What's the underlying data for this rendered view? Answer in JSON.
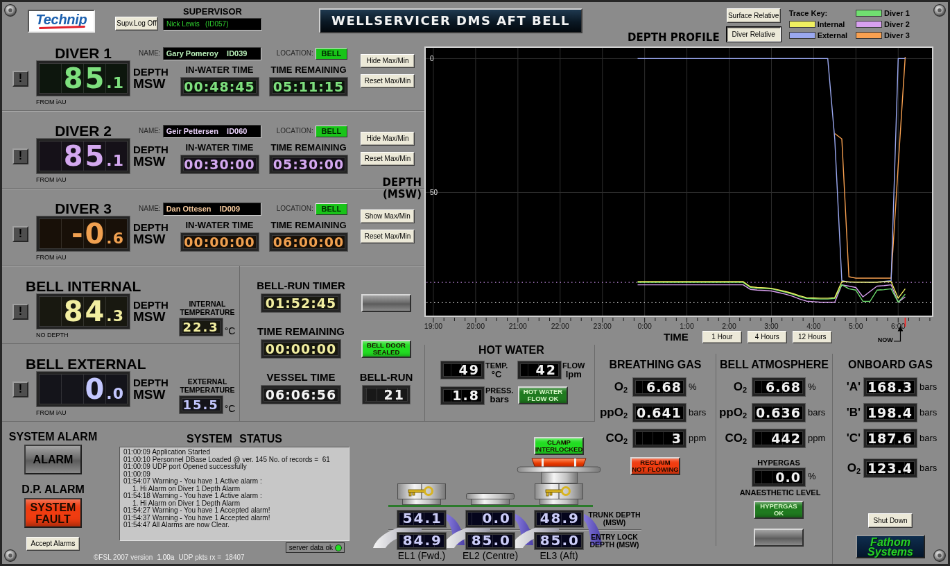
{
  "window": {
    "title": "WELLSERVICER DMS AFT BELL",
    "logo": "Technip",
    "vendor_logo": "Fathom Systems"
  },
  "supervisor": {
    "button": "Supv.Log Off",
    "label": "SUPERVISOR",
    "value": "Nick Lewis   (ID057)"
  },
  "divers": [
    {
      "title": "DIVER 1",
      "color": "#7ee07e",
      "alarm_button": "!",
      "name_label": "NAME:",
      "name": "Gary Pomeroy    ID039",
      "location_label": "LOCATION:",
      "location": "BELL",
      "depth": "85.1",
      "depth_label": "DEPTH",
      "depth_unit": "MSW",
      "source": "FROM iAU",
      "in_water_label": "IN-WATER TIME",
      "in_water": "00:48:45",
      "remaining_label": "TIME REMAINING",
      "remaining": "05:11:15",
      "buttons": [
        "Hide Max/Min",
        "Reset Max/Min"
      ]
    },
    {
      "title": "DIVER 2",
      "color": "#d4a8f0",
      "alarm_button": "!",
      "name_label": "NAME:",
      "name": "Geir Pettersen    ID060",
      "location_label": "LOCATION:",
      "location": "BELL",
      "depth": "85.1",
      "depth_label": "DEPTH",
      "depth_unit": "MSW",
      "source": "FROM iAU",
      "in_water_label": "IN-WATER TIME",
      "in_water": "00:30:00",
      "remaining_label": "TIME REMAINING",
      "remaining": "05:30:00",
      "buttons": [
        "Hide Max/Min",
        "Reset Max/Min"
      ]
    },
    {
      "title": "DIVER 3",
      "color": "#f0a050",
      "alarm_button": "!",
      "name_label": "NAME:",
      "name": "Dan Ottesen    ID009",
      "location_label": "LOCATION:",
      "location": "BELL",
      "depth": "-0.6",
      "depth_label": "DEPTH",
      "depth_unit": "MSW",
      "source": "FROM iAU",
      "in_water_label": "IN-WATER TIME",
      "in_water": "00:00:00",
      "remaining_label": "TIME REMAINING",
      "remaining": "06:00:00",
      "buttons": [
        "Show Max/Min",
        "Reset Max/Min"
      ]
    }
  ],
  "depth_profile": {
    "view_buttons": [
      {
        "text": "Surface Relative",
        "selected": false
      },
      {
        "text": "Diver Relative",
        "selected": true
      }
    ],
    "trace_key_label": "Trace Key:",
    "range_buttons": [
      "1 Hour",
      "4 Hours",
      "12 Hours"
    ],
    "now_label": "NOW",
    "chart_data": {
      "type": "line",
      "title": "DEPTH PROFILE",
      "xlabel": "TIME",
      "ylabel": "DEPTH (MSW)",
      "grid": true,
      "categories": [
        "19:00",
        null,
        null,
        null,
        null,
        null,
        "20:00",
        null,
        null,
        null,
        null,
        null,
        "21:00",
        null,
        null,
        null,
        null,
        null,
        "22:00",
        null,
        null,
        null,
        null,
        null,
        "23:00",
        null,
        null,
        null,
        null,
        null,
        "0:00",
        null,
        null,
        null,
        null,
        null,
        "1:00",
        null,
        null,
        null,
        null,
        null,
        "2:00",
        null,
        null,
        null,
        null,
        null,
        "3:00",
        null,
        null,
        null,
        null,
        null,
        "4:00",
        null,
        null,
        null,
        null,
        null,
        "5:00",
        null,
        null,
        null,
        null,
        null,
        "6:00",
        null,
        null,
        null,
        null
      ],
      "series": [
        {
          "name": "Internal",
          "color": "#f0f060",
          "values": [
            null,
            null,
            null,
            null,
            null,
            null,
            null,
            null,
            null,
            null,
            null,
            null,
            null,
            null,
            null,
            null,
            null,
            null,
            null,
            null,
            null,
            null,
            null,
            null,
            null,
            null,
            null,
            null,
            null,
            83.3,
            83.3,
            83.3,
            83.3,
            83.3,
            83.3,
            83.3,
            83.3,
            83.3,
            83.3,
            83.3,
            83.3,
            83.3,
            83.3,
            83.3,
            83.3,
            85.2,
            85.5,
            85.6,
            85.8,
            86.4,
            87.0,
            87.7,
            88.6,
            89.3,
            89.4,
            89.5,
            89.5,
            89.3,
            83.3,
            83.4,
            83.5,
            83.5,
            83.6,
            83.5,
            83.4,
            83.3,
            89.5,
            86,
            null,
            null,
            null
          ]
        },
        {
          "name": "External",
          "color": "#9aa8f0",
          "values": [
            null,
            null,
            null,
            null,
            null,
            null,
            null,
            null,
            null,
            null,
            null,
            null,
            null,
            null,
            null,
            null,
            null,
            null,
            null,
            null,
            null,
            null,
            null,
            null,
            null,
            null,
            null,
            null,
            null,
            0,
            0,
            0,
            0,
            0,
            0,
            0,
            0,
            0,
            0,
            0,
            0,
            0,
            0,
            0,
            0,
            0,
            0,
            0,
            0,
            0,
            0,
            0,
            0,
            0,
            0,
            0,
            0,
            30,
            83,
            83.5,
            83.5,
            83.5,
            83.5,
            83.5,
            83.2,
            83,
            0,
            0,
            null,
            null,
            null
          ]
        },
        {
          "name": "Diver 1",
          "color": "#70e070",
          "values": [
            null,
            null,
            null,
            null,
            null,
            null,
            null,
            null,
            null,
            null,
            null,
            null,
            null,
            null,
            null,
            null,
            null,
            null,
            null,
            null,
            null,
            null,
            null,
            null,
            null,
            null,
            null,
            null,
            null,
            83.6,
            83.6,
            83.6,
            83.6,
            83.6,
            83.6,
            83.6,
            83.6,
            83.6,
            83.6,
            83.6,
            83.6,
            83.6,
            83.6,
            83.6,
            83.6,
            85.5,
            85.8,
            85.9,
            86.0,
            86.6,
            87.3,
            88.0,
            88.9,
            89.6,
            89.7,
            89.8,
            89.8,
            89.6,
            84.5,
            86,
            86.5,
            90.7,
            90.7,
            86.5,
            86.3,
            86,
            91,
            88,
            null,
            null,
            null
          ]
        },
        {
          "name": "Diver 2",
          "color": "#d8a0f0",
          "values": [
            null,
            null,
            null,
            null,
            null,
            null,
            null,
            null,
            null,
            null,
            null,
            null,
            null,
            null,
            null,
            null,
            null,
            null,
            null,
            null,
            null,
            null,
            null,
            null,
            null,
            null,
            null,
            null,
            null,
            84.5,
            84.5,
            84.5,
            84.5,
            84.5,
            84.5,
            84.5,
            84.5,
            84.5,
            84.5,
            84.5,
            84.5,
            84.5,
            84.5,
            84.5,
            84.5,
            86.2,
            86.5,
            86.6,
            86.8,
            87.4,
            88.0,
            88.8,
            89.8,
            90.6,
            90.8,
            91,
            91,
            91,
            84.5,
            85,
            85.5,
            89,
            87,
            85,
            84.8,
            84.5,
            91,
            89,
            null,
            null,
            null
          ]
        },
        {
          "name": "Diver 3",
          "color": "#f8a050",
          "values": [
            null,
            null,
            null,
            null,
            null,
            null,
            null,
            null,
            null,
            null,
            null,
            null,
            null,
            null,
            null,
            null,
            null,
            null,
            null,
            null,
            null,
            null,
            null,
            null,
            null,
            null,
            null,
            null,
            null,
            null,
            null,
            null,
            null,
            null,
            null,
            null,
            null,
            null,
            null,
            null,
            null,
            null,
            null,
            null,
            null,
            null,
            null,
            null,
            null,
            null,
            null,
            null,
            null,
            null,
            null,
            null,
            null,
            28,
            30,
            81.5,
            82,
            82,
            82,
            82,
            82,
            82,
            40,
            -0.6,
            null,
            null,
            null
          ]
        }
      ],
      "ylim": [
        96,
        -4
      ],
      "yticks": [
        0,
        50
      ],
      "ref_lines": [
        {
          "axis": "y",
          "value": 83.6,
          "color": "#c890e8"
        },
        {
          "axis": "y",
          "value": 91.2,
          "color": "#d8d8d8"
        }
      ]
    }
  },
  "bell_gauges": [
    {
      "title": "BELL INTERNAL",
      "color": "#f2eea0",
      "alarm_button": "!",
      "depth": "84.3",
      "depth_label": "DEPTH",
      "depth_unit": "MSW",
      "source": "NO DEPTH",
      "temp_label": "INTERNAL TEMPERATURE",
      "temp": "22.3",
      "temp_unit": "°C"
    },
    {
      "title": "BELL EXTERNAL",
      "color": "#c4c8ff",
      "alarm_button": "!",
      "depth": "0.0",
      "depth_label": "DEPTH",
      "depth_unit": "MSW",
      "source": "FROM iAU",
      "temp_label": "EXTERNAL TEMPERATURE",
      "temp": "15.5",
      "temp_unit": "°C"
    }
  ],
  "bell_run": {
    "cells": [
      {
        "kind": "timer",
        "label": "BELL-RUN TIMER",
        "value": "01:52:45",
        "color": "#f2eea0"
      },
      {
        "kind": "indicator",
        "on": false
      },
      {
        "kind": "timer",
        "label": "TIME REMAINING",
        "value": "00:00:00",
        "color": "#f2eea0"
      },
      {
        "kind": "indicator",
        "text": "BELL DOOR\nSEALED",
        "on": true,
        "color": "#22dd22"
      },
      {
        "kind": "timer",
        "label": "VESSEL TIME",
        "value": "06:06:56",
        "color": "#f4f4f4"
      },
      {
        "kind": "counter",
        "label": "BELL-RUN",
        "value": "21",
        "color": "#f4f4f4"
      }
    ]
  },
  "alarms": {
    "system_label": "SYSTEM ALARM",
    "system_button": {
      "text": "ALARM",
      "on": false
    },
    "dp_label": "D.P. ALARM",
    "dp_button": {
      "text": "SYSTEM\nFAULT",
      "on": true,
      "color": "#f03c10"
    },
    "accept_button": "Accept Alarms"
  },
  "system_status": {
    "title": "SYSTEM STATUS",
    "log": [
      {
        "text": "01:00:09 Application Started"
      },
      {
        "text": "01:00:10 Personnel DBase Loaded @ ver. 145 No. of records =  61"
      },
      {
        "text": "01:00:09 UDP port Opened successfully"
      },
      {
        "text": "01:00:09"
      },
      {
        "text": "01:54:07 Warning - You have 1 Active alarm :",
        "children": [
          {
            "text": "1. Hi Alarm on Diver 1 Depth Alarm"
          }
        ]
      },
      {
        "text": "01:54:18 Warning - You have 1 Active alarm :",
        "children": [
          {
            "text": "1. Hi Alarm on Diver 1 Depth Alarm"
          }
        ]
      },
      {
        "text": "01:54:27 Warning - You have 1 Accepted alarm!"
      },
      {
        "text": "01:54:37 Warning - You have 1 Accepted alarm!"
      },
      {
        "text": "01:54:47 All Alarms are now Clear."
      }
    ],
    "server": {
      "text": "server data ok",
      "ok": true
    }
  },
  "footer": {
    "copyright": "©FSL 2007 version",
    "version": "1.00a",
    "packets": "UDP pkts rx =  18407"
  },
  "hot_water": {
    "title": "HOT WATER",
    "readings": [
      {
        "value": "49",
        "label": "TEMP.",
        "unit": "°C"
      },
      {
        "value": "42",
        "label": "FLOW",
        "unit": "lpm"
      },
      {
        "value": "1.8",
        "label": "PRESS.",
        "unit": "bars"
      }
    ],
    "indicator": {
      "text": "HOT WATER\nFLOW OK",
      "on": true,
      "color": "#1f7a1f"
    }
  },
  "trunk": {
    "clamp": {
      "text": "CLAMP\nINTERLOCKED",
      "on": true,
      "color": "#22dd22"
    },
    "trunk_label": "TRUNK DEPTH (MSW)",
    "lock_label": "ENTRY LOCK DEPTH (MSW)",
    "locks": [
      {
        "name": "EL1 (Fwd.)",
        "locked": true,
        "clamped": false,
        "trunk_depth": "54.1",
        "lock_depth": "84.9"
      },
      {
        "name": "EL2 (Centre)",
        "locked": false,
        "clamped": false,
        "trunk_depth": "0.0",
        "lock_depth": "85.0"
      },
      {
        "name": "EL3 (Aft)",
        "locked": true,
        "clamped": true,
        "trunk_depth": "48.9",
        "lock_depth": "85.0"
      }
    ]
  },
  "breathing_gas": {
    "title": "BREATHING GAS",
    "readings": [
      {
        "label": "O$_{2}$",
        "value": "6.68",
        "unit": "%"
      },
      {
        "label": "ppO$_{2}$",
        "value": "0.641",
        "unit": "bars"
      },
      {
        "label": "CO$_{2}$",
        "value": "3",
        "unit": "ppm"
      }
    ],
    "indicator": {
      "text": "RECLAIM\nNOT FLOWING",
      "on": true,
      "color": "#f03c10"
    }
  },
  "bell_atmosphere": {
    "title": "BELL ATMOSPHERE",
    "readings": [
      {
        "label": "O$_{2}$",
        "value": "6.68",
        "unit": "%"
      },
      {
        "label": "ppO$_{2}$",
        "value": "0.636",
        "unit": "bars"
      },
      {
        "label": "CO$_{2}$",
        "value": "442",
        "unit": "ppm"
      }
    ],
    "hypergas": {
      "label": "HYPERGAS",
      "value": "0.0",
      "unit": "%",
      "caption": "ANAESTHETIC LEVEL"
    },
    "indicators": [
      {
        "text": "HYPERGAS OK",
        "on": true,
        "color": "#1f7a1f"
      },
      {
        "on": false
      }
    ]
  },
  "onboard_gas": {
    "title": "ONBOARD GAS",
    "readings": [
      {
        "label": "'A'",
        "value": "168.3",
        "unit": "bars"
      },
      {
        "label": "'B'",
        "value": "198.4",
        "unit": "bars"
      },
      {
        "label": "'C'",
        "value": "187.6",
        "unit": "bars"
      },
      {
        "label": "O$_{2}$",
        "value": "123.4",
        "unit": "bars"
      }
    ],
    "button": "Shut Down"
  }
}
